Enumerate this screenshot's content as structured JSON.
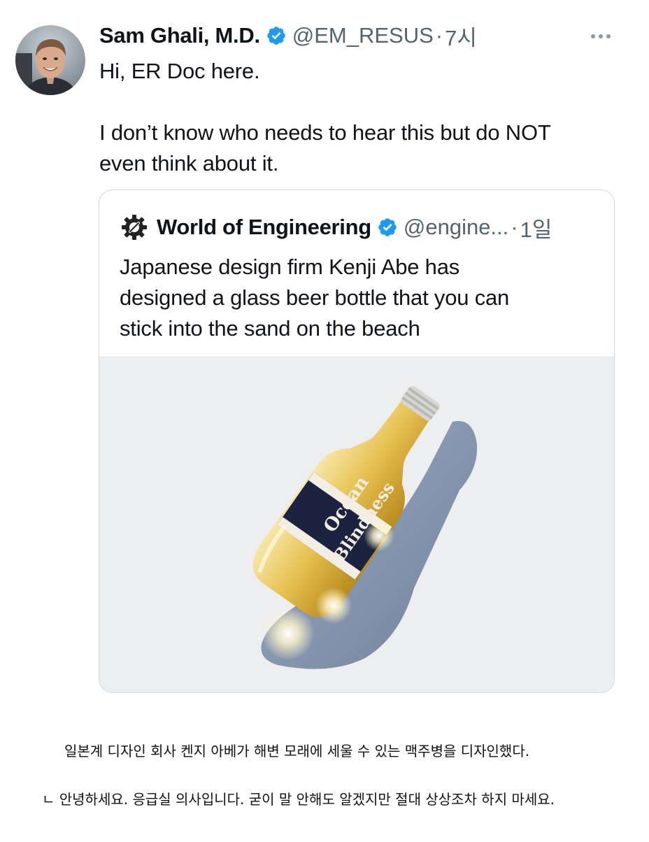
{
  "tweet": {
    "author_name": "Sam Ghali, M.D.",
    "handle": "@EM_RESUS",
    "separator": "·",
    "time": "7시",
    "lines": [
      "Hi, ER Doc here.",
      "I don’t know who needs to hear this but do NOT",
      "even think about it."
    ]
  },
  "quoted_tweet": {
    "author_name": "World of Engineering",
    "handle": "@engine...",
    "separator": "·",
    "time": "1일",
    "lines": [
      "Japanese design firm Kenji Abe has",
      "designed a glass beer bottle that you can",
      "stick into the sand on the beach"
    ],
    "media": {
      "label_lines": [
        "Ocean",
        "Blindness"
      ]
    }
  },
  "captions": [
    "일본계 디자인 회사 켄지 아베가 해변 모래에 세울 수 있는 맥주병을 디자인했다.",
    "ㄴ 안녕하세요. 응급실 의사입니다. 굳이 말 안해도 알겠지만 절대 상상조차 하지 마세요."
  ],
  "icons": {
    "verified": "verified-badge-icon",
    "more": "more-options-icon",
    "logo": "gear-logo-icon"
  },
  "colors": {
    "verified_blue": "#1d9bf0",
    "muted_text": "#536471",
    "border": "#cfd9de",
    "media_bg": "#eceef0"
  }
}
